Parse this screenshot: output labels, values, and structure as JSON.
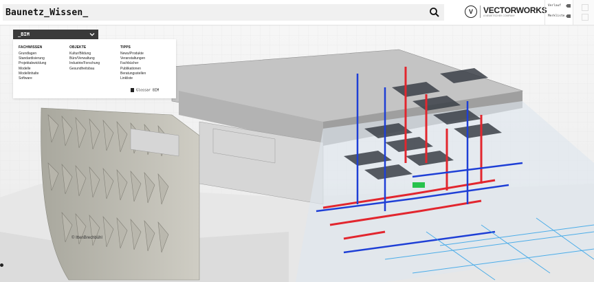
{
  "header": {
    "site_title": "Baunetz_Wissen_",
    "brand": {
      "mark": "V",
      "name": "VECTORWORKS",
      "tagline": "A NEMETSCHEK COMPANY"
    },
    "side_links": [
      {
        "label": "Verlauf",
        "icon": "arrow-icon"
      },
      {
        "label": "Merkliste",
        "icon": "arrow-icon"
      }
    ]
  },
  "menu": {
    "dropdown_label": "_BIM",
    "columns": [
      {
        "heading": "FACHWISSEN",
        "items": [
          "Grundlagen",
          "Standardisierung",
          "Projektabwicklung",
          "Modelle",
          "Modellinhalte",
          "Software"
        ]
      },
      {
        "heading": "OBJEKTE",
        "items": [
          "Kultur/Bildung",
          "Büro/Verwaltung",
          "Industrie/Forschung",
          "Gesundheitsbau"
        ]
      },
      {
        "heading": "TIPPS",
        "items": [
          "News/Produkte",
          "Veranstaltungen",
          "Fachbücher",
          "Publikationen",
          "Beratungsstellen",
          "Linkliste"
        ]
      }
    ],
    "glossar_label": "Glossar BIM"
  },
  "hero": {
    "credit": "© IttenBrechbühl"
  },
  "colors": {
    "menu_bg": "#3a3a3a",
    "search_bg": "#f0f0f0",
    "pipe_red": "#e2262e",
    "pipe_blue": "#1e3fd6",
    "pipe_cyan": "#3aa6e8"
  }
}
